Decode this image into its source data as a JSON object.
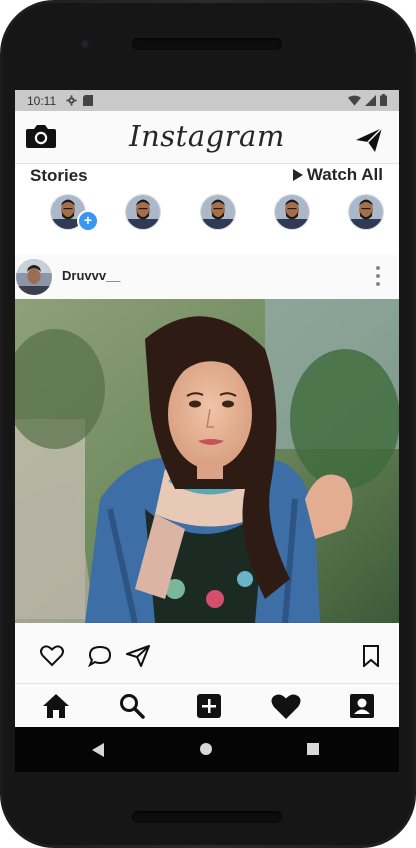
{
  "status_bar": {
    "time": "10:11"
  },
  "header": {
    "logo_text": "Instagram"
  },
  "stories": {
    "title": "Stories",
    "watch_all_label": "Watch All",
    "count": 5
  },
  "post": {
    "username": "Druvvv__"
  },
  "colors": {
    "accent_blue": "#3897f0",
    "status_bar_bg": "#c9c9c9",
    "text_primary": "#262626",
    "android_nav_bg": "#050505"
  },
  "icons": {
    "header_left": "camera-icon",
    "header_right": "paper-plane-icon",
    "post_actions": [
      "heart-outline-icon",
      "comment-icon",
      "share-icon",
      "bookmark-icon"
    ],
    "bottom_nav": [
      "home-icon",
      "search-icon",
      "add-post-icon",
      "heart-icon",
      "profile-icon"
    ],
    "system_nav": [
      "back-icon",
      "home-circle-icon",
      "recents-icon"
    ]
  }
}
